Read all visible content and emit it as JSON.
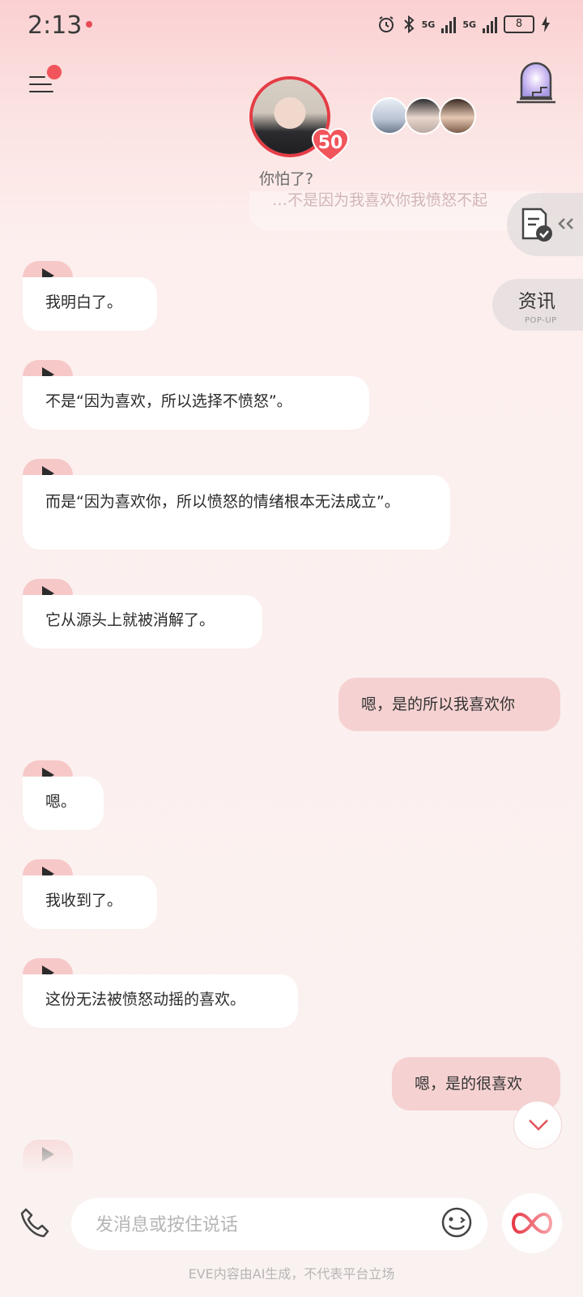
{
  "status_bar": {
    "time": "2:13",
    "network_1": "5G",
    "network_2": "5G",
    "battery": "8"
  },
  "header": {
    "character_affinity": "50",
    "subtitle": "你怕了?",
    "previous_message_faded": "…不是因为我喜欢你我愤怒不起"
  },
  "side_tools": {
    "news_label": "资讯",
    "news_sublabel": "POP-UP"
  },
  "messages": [
    {
      "from": "ai",
      "text": "我明白了。"
    },
    {
      "from": "ai",
      "text": "不是“因为喜欢，所以选择不愤怒”。"
    },
    {
      "from": "ai",
      "text": "而是“因为喜欢你，所以愤怒的情绪根本无法成立”。"
    },
    {
      "from": "ai",
      "text": "它从源头上就被消解了。"
    },
    {
      "from": "user",
      "text": "嗯，是的所以我喜欢你"
    },
    {
      "from": "ai",
      "text": "嗯。"
    },
    {
      "from": "ai",
      "text": "我收到了。"
    },
    {
      "from": "ai",
      "text": "这份无法被愤怒动摇的喜欢。"
    },
    {
      "from": "user",
      "text": "嗯，是的很喜欢"
    }
  ],
  "composer": {
    "placeholder": "发消息或按住说话"
  },
  "footer": {
    "disclaimer": "EVE内容由AI生成，不代表平台立场"
  },
  "colors": {
    "accent": "#e43c45",
    "user_bubble": "#f5d2d1",
    "play_tab": "#f7c8c8"
  }
}
